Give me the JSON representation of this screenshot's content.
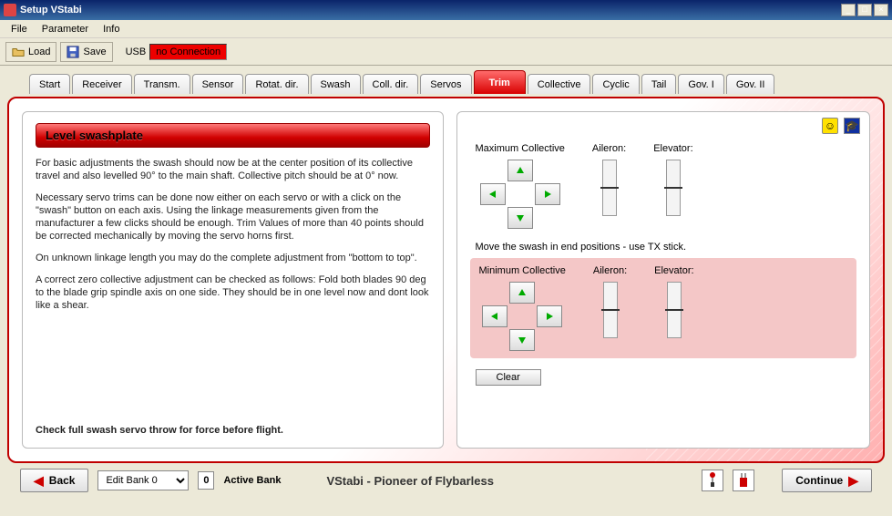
{
  "window": {
    "title": "Setup VStabi"
  },
  "menu": {
    "file": "File",
    "parameter": "Parameter",
    "info": "Info"
  },
  "toolbar": {
    "load": "Load",
    "save": "Save",
    "usb_label": "USB",
    "usb_status": "no Connection"
  },
  "tabs": [
    "Start",
    "Receiver",
    "Transm.",
    "Sensor",
    "Rotat. dir.",
    "Swash",
    "Coll. dir.",
    "Servos",
    "Trim",
    "Collective",
    "Cyclic",
    "Tail",
    "Gov. I",
    "Gov. II"
  ],
  "active_tab": "Trim",
  "left_panel": {
    "title": "Level swashplate",
    "p1": "For basic adjustments the swash should now be at the center position of its collective travel and also levelled  90° to the main shaft. Collective pitch should be at 0° now.",
    "p2": "Necessary servo trims can be done now either on each servo or with a click on the \"swash\" button on each axis. Using the linkage measurements given from the manufacturer a few clicks should be enough. Trim Values of more than 40 points should be corrected mechanically by moving the servo horns first.",
    "p3": "On unknown linkage length you may do the complete adjustment from \"bottom to top\".",
    "p4": "A correct zero collective adjustment can be checked as follows: Fold both blades 90 deg to the blade grip spindle axis on one side. They should be in one level now and dont look like a shear.",
    "p5": "Check full swash servo throw for force before flight."
  },
  "right_panel": {
    "max_collective": "Maximum Collective",
    "aileron": "Aileron:",
    "elevator": "Elevator:",
    "instruction": "Move the swash in end positions - use TX stick.",
    "min_collective": "Minimum Collective",
    "clear": "Clear"
  },
  "bottom": {
    "back": "Back",
    "continue": "Continue",
    "bank_option": "Edit Bank 0",
    "bank_num": "0",
    "bank_label": "Active Bank",
    "brand": "VStabi - Pioneer of Flybarless"
  },
  "icons": {
    "smiley": "☺",
    "grad": "🎓",
    "joystick": "🕹",
    "radio": "📶"
  },
  "colors": {
    "accent": "#c00000"
  }
}
